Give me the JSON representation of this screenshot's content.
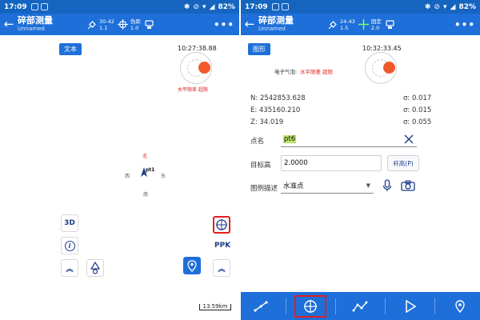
{
  "left": {
    "status": {
      "time": "17:09",
      "battery": "82%"
    },
    "title": {
      "main": "碎部测量",
      "sub": "Unnamed"
    },
    "sat": {
      "ratio": "30-42",
      "sub": "1.1"
    },
    "solution": {
      "label": "伪距",
      "value": "1.0"
    },
    "chip_label": "文本",
    "clock": "10:27:38.88",
    "bubble_label": "水平限差 超限",
    "compass_labels": {
      "north": "北",
      "east": "东",
      "west": "西",
      "south": "南"
    },
    "point_label": "pt1",
    "side_buttons": {
      "three_d": "3D",
      "info": "i",
      "ppk": "PPK"
    },
    "scale": "13.59km"
  },
  "right": {
    "status": {
      "time": "17:09",
      "battery": "82%"
    },
    "title": {
      "main": "碎部测量",
      "sub": "Unnamed"
    },
    "sat": {
      "ratio": "24-43",
      "sub": "1.5"
    },
    "solution": {
      "label": "固定",
      "value": "2.0"
    },
    "chip_label": "图形",
    "clock": "10:32:33.45",
    "bubble_caption": "电子气泡:",
    "bubble_label": "水平限差 超限",
    "coords": [
      {
        "label": "N:",
        "value": "2542853.628",
        "sigma_label": "σ:",
        "sigma": "0.017"
      },
      {
        "label": "E:",
        "value": "435160.210",
        "sigma_label": "σ:",
        "sigma": "0.015"
      },
      {
        "label": "Z:",
        "value": "34.019",
        "sigma_label": "σ:",
        "sigma": "0.055"
      }
    ],
    "fields": {
      "point_name_label": "点名",
      "point_name_value": "pt6",
      "target_height_label": "目标高",
      "target_height_value": "2.0000",
      "rod_button": "杆高(P)",
      "legend_label": "图例描述",
      "legend_value": "水准点"
    }
  },
  "colors": {
    "primary": "#1e6fd9",
    "status_bar": "#1565c0",
    "accent_red": "#e02020",
    "bubble": "#f05a28",
    "highlight": "#b9e66a"
  },
  "icons": [
    "back-arrow-icon",
    "satellite-icon",
    "crosshair-icon",
    "device-icon",
    "more-icon",
    "info-icon",
    "chevron-up-icon",
    "stakeout-icon",
    "location-pin-icon",
    "target-point-icon",
    "clear-icon",
    "microphone-icon",
    "camera-icon",
    "line-icon",
    "polyline-icon",
    "play-icon"
  ]
}
